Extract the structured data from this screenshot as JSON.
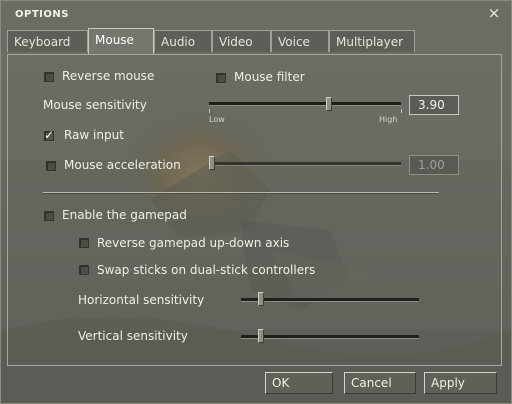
{
  "window": {
    "title": "OPTIONS",
    "close_glyph": "×"
  },
  "tabs": [
    {
      "label": "Keyboard",
      "active": false
    },
    {
      "label": "Mouse",
      "active": true
    },
    {
      "label": "Audio",
      "active": false
    },
    {
      "label": "Video",
      "active": false
    },
    {
      "label": "Voice",
      "active": false
    },
    {
      "label": "Multiplayer",
      "active": false
    }
  ],
  "mouse": {
    "reverse_mouse": {
      "label": "Reverse mouse",
      "checked": false
    },
    "mouse_filter": {
      "label": "Mouse filter",
      "checked": false
    },
    "sensitivity": {
      "label": "Mouse sensitivity",
      "low_label": "Low",
      "high_label": "High",
      "value": "3.90",
      "level": 0.63
    },
    "raw_input": {
      "label": "Raw input",
      "checked": true
    },
    "acceleration": {
      "label": "Mouse acceleration",
      "checked": false,
      "value": "1.00",
      "level": 0.0,
      "enabled": false
    },
    "gamepad": {
      "enable": {
        "label": "Enable the gamepad",
        "checked": false
      },
      "reverse_updown": {
        "label": "Reverse gamepad up-down axis",
        "checked": false
      },
      "swap_sticks": {
        "label": "Swap sticks on dual-stick controllers",
        "checked": false
      },
      "horizontal": {
        "label": "Horizontal sensitivity",
        "level": 0.1
      },
      "vertical": {
        "label": "Vertical sensitivity",
        "level": 0.1
      }
    }
  },
  "buttons": {
    "ok": "OK",
    "cancel": "Cancel",
    "apply": "Apply"
  },
  "colors": {
    "window_tint": "#686b62",
    "text": "#eef0e6",
    "border": "#a6a89e"
  },
  "icons": {
    "close": "close-icon",
    "check": "checkmark-icon"
  }
}
